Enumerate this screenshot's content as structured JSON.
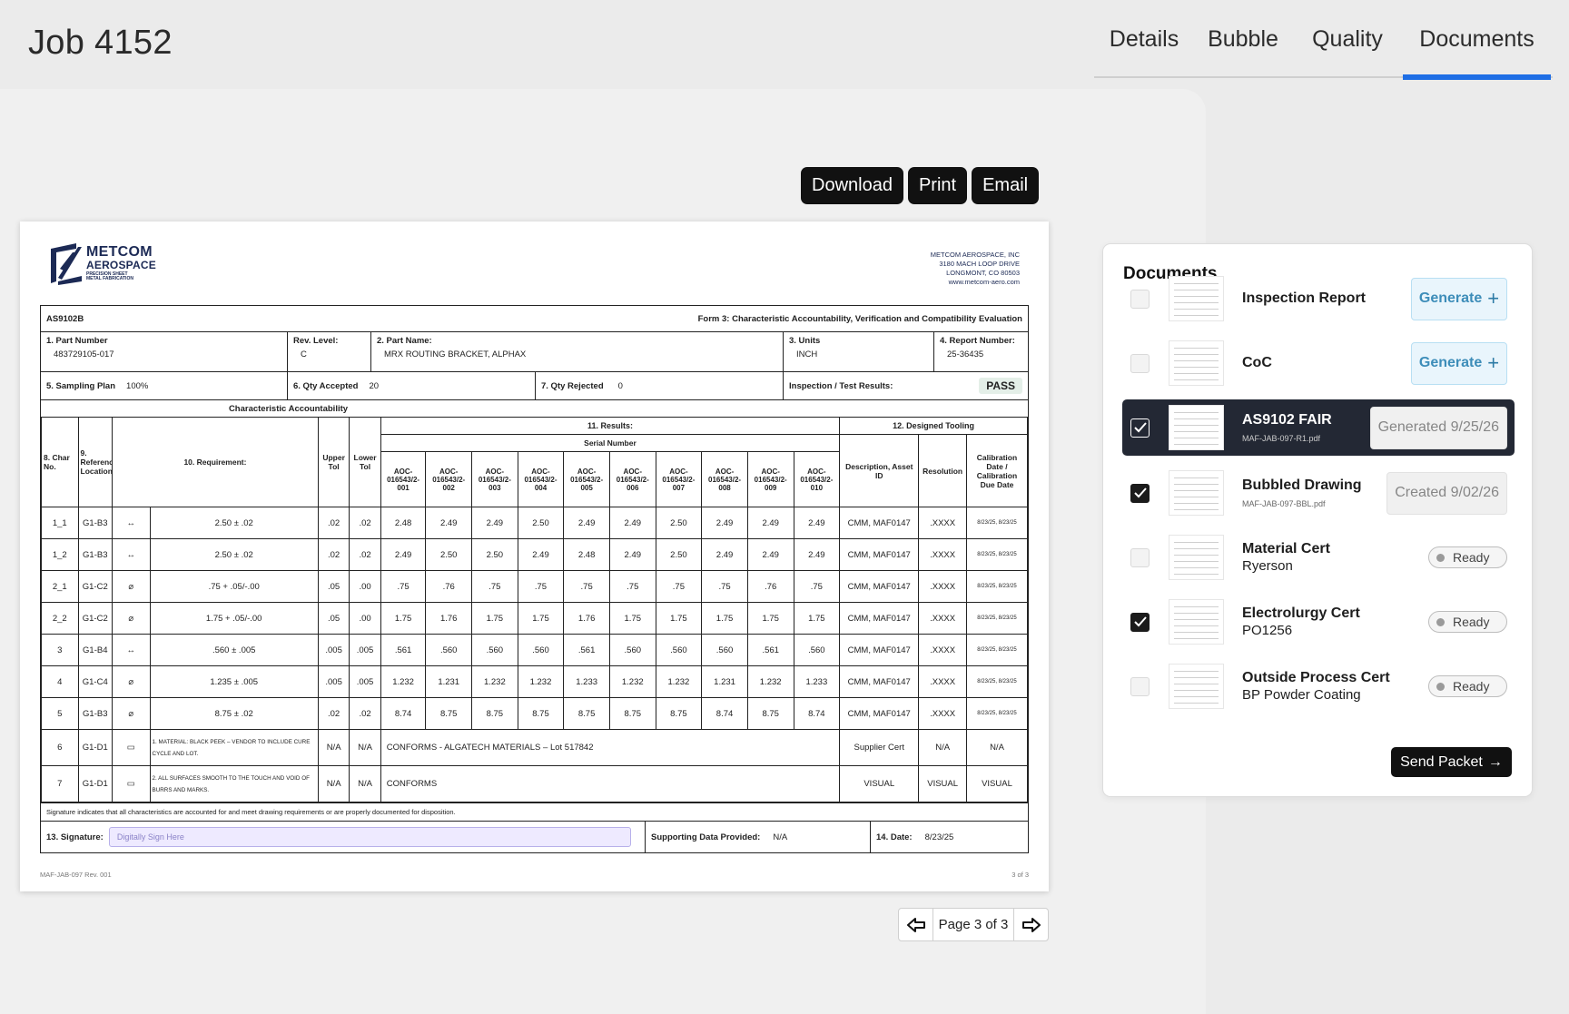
{
  "header": {
    "title": "Job 4152",
    "tabs": [
      {
        "label": "Details"
      },
      {
        "label": "Bubble"
      },
      {
        "label": "Quality"
      },
      {
        "label": "Documents"
      }
    ],
    "active_tab": "Documents"
  },
  "toolbar": {
    "download": "Download",
    "print": "Print",
    "email": "Email"
  },
  "document": {
    "logo_line1": "METCOM",
    "logo_line2": "AEROSPACE",
    "logo_line3": "PRECISION SHEET",
    "logo_line4": "METAL FABRICATION",
    "address": [
      "METCOM AEROSPACE, INC",
      "3180 MACH LOOP DRIVE",
      "LONGMONT, CO 80503",
      "www.metcom-aero.com"
    ],
    "standard": "AS9102B",
    "form_title": "Form 3: Characteristic Accountability, Verification and Compatibility Evaluation",
    "part_number_label": "1. Part Number",
    "part_number": "483729105-017",
    "rev_label": "Rev. Level:",
    "rev": "C",
    "part_name_label": "2. Part Name:",
    "part_name": "MRX ROUTING BRACKET, ALPHAX",
    "units_label": "3. Units",
    "units": "INCH",
    "report_label": "4. Report Number:",
    "report": "25-36435",
    "sampling_label": "5. Sampling Plan",
    "sampling": "100%",
    "qty_acc_label": "6. Qty Accepted",
    "qty_acc": "20",
    "qty_rej_label": "7. Qty Rejected",
    "qty_rej": "0",
    "results_label": "Inspection / Test Results:",
    "results": "PASS",
    "section_title": "Characteristic Accountability",
    "h_char": "8. Char No.",
    "h_ref": "9. Reference Location:",
    "h_req": "10. Requirement:",
    "h_upper": "Upper Tol",
    "h_lower": "Lower Tol",
    "h_results": "11. Results:",
    "h_serial": "Serial Number",
    "h_tooling": "12. Designed Tooling",
    "h_desc": "Description, Asset ID",
    "h_res": "Resolution",
    "h_cal": "Calibration Date / Calibration Due Date",
    "serials": [
      "AOC-016543/2-001",
      "AOC-016543/2-002",
      "AOC-016543/2-003",
      "AOC-016543/2-004",
      "AOC-016543/2-005",
      "AOC-016543/2-006",
      "AOC-016543/2-007",
      "AOC-016543/2-008",
      "AOC-016543/2-009",
      "AOC-016543/2-010"
    ],
    "rows": [
      {
        "no": "1_1",
        "ref": "G1-B3",
        "sym": "↔",
        "req": "2.50 ± .02",
        "up": ".02",
        "lo": ".02",
        "vals": [
          "2.48",
          "2.49",
          "2.49",
          "2.50",
          "2.49",
          "2.49",
          "2.50",
          "2.49",
          "2.49",
          "2.49"
        ],
        "desc": "CMM, MAF0147",
        "res": ".XXXX",
        "cal": "8/23/25, 8/23/25"
      },
      {
        "no": "1_2",
        "ref": "G1-B3",
        "sym": "↔",
        "req": "2.50 ± .02",
        "up": ".02",
        "lo": ".02",
        "vals": [
          "2.49",
          "2.50",
          "2.50",
          "2.49",
          "2.48",
          "2.49",
          "2.50",
          "2.49",
          "2.49",
          "2.49"
        ],
        "desc": "CMM, MAF0147",
        "res": ".XXXX",
        "cal": "8/23/25, 8/23/25"
      },
      {
        "no": "2_1",
        "ref": "G1-C2",
        "sym": "⌀",
        "req": ".75 + .05/-.00",
        "up": ".05",
        "lo": ".00",
        "vals": [
          ".75",
          ".76",
          ".75",
          ".75",
          ".75",
          ".75",
          ".75",
          ".75",
          ".76",
          ".75"
        ],
        "desc": "CMM, MAF0147",
        "res": ".XXXX",
        "cal": "8/23/25, 8/23/25"
      },
      {
        "no": "2_2",
        "ref": "G1-C2",
        "sym": "⌀",
        "req": "1.75 + .05/-.00",
        "up": ".05",
        "lo": ".00",
        "vals": [
          "1.75",
          "1.76",
          "1.75",
          "1.75",
          "1.76",
          "1.75",
          "1.75",
          "1.75",
          "1.75",
          "1.75"
        ],
        "desc": "CMM, MAF0147",
        "res": ".XXXX",
        "cal": "8/23/25, 8/23/25"
      },
      {
        "no": "3",
        "ref": "G1-B4",
        "sym": "↔",
        "req": ".560 ± .005",
        "up": ".005",
        "lo": ".005",
        "vals": [
          ".561",
          ".560",
          ".560",
          ".560",
          ".561",
          ".560",
          ".560",
          ".560",
          ".561",
          ".560"
        ],
        "desc": "CMM, MAF0147",
        "res": ".XXXX",
        "cal": "8/23/25, 8/23/25"
      },
      {
        "no": "4",
        "ref": "G1-C4",
        "sym": "⌀",
        "req": "1.235 ± .005",
        "up": ".005",
        "lo": ".005",
        "vals": [
          "1.232",
          "1.231",
          "1.232",
          "1.232",
          "1.233",
          "1.232",
          "1.232",
          "1.231",
          "1.232",
          "1.233"
        ],
        "desc": "CMM, MAF0147",
        "res": ".XXXX",
        "cal": "8/23/25, 8/23/25"
      },
      {
        "no": "5",
        "ref": "G1-B3",
        "sym": "⌀",
        "req": "8.75 ± .02",
        "up": ".02",
        "lo": ".02",
        "vals": [
          "8.74",
          "8.75",
          "8.75",
          "8.75",
          "8.75",
          "8.75",
          "8.75",
          "8.74",
          "8.75",
          "8.74"
        ],
        "desc": "CMM, MAF0147",
        "res": ".XXXX",
        "cal": "8/23/25, 8/23/25"
      }
    ],
    "note_rows": [
      {
        "no": "6",
        "ref": "G1-D1",
        "sym": "▭",
        "req": "1. MATERIAL: BLACK PEEK – VENDOR TO INCLUDE CURE CYCLE AND LOT.",
        "up": "N/A",
        "lo": "N/A",
        "result": "CONFORMS - ALGATECH MATERIALS – Lot 517842",
        "desc": "Supplier Cert",
        "res": "N/A",
        "cal": "N/A"
      },
      {
        "no": "7",
        "ref": "G1-D1",
        "sym": "▭",
        "req": "2. ALL SURFACES SMOOTH TO THE TOUCH AND VOID OF BURRS AND MARKS.",
        "up": "N/A",
        "lo": "N/A",
        "result": "CONFORMS",
        "desc": "VISUAL",
        "res": "VISUAL",
        "cal": "VISUAL"
      }
    ],
    "signature_note": "Signature indicates that all characteristics are accounted for and meet drawing requirements or are properly documented for disposition.",
    "signature_label": "13. Signature:",
    "signature_placeholder": "Digitally Sign Here",
    "supporting_label": "Supporting Data Provided:",
    "supporting": "N/A",
    "date_label": "14. Date:",
    "date": "8/23/25",
    "footer_left": "MAF-JAB-097 Rev. 001",
    "footer_right": "3 of 3"
  },
  "pager": {
    "label": "Page 3 of 3"
  },
  "documents_panel": {
    "title": "Documents",
    "items": [
      {
        "title": "Inspection Report",
        "sub": "",
        "action": "Generate",
        "checked": false
      },
      {
        "title": "CoC",
        "sub": "",
        "action": "Generate",
        "checked": false
      },
      {
        "title": "AS9102 FAIR",
        "sub": "MAF-JAB-097-R1.pdf",
        "status": "Generated 9/25/26",
        "checked": true
      },
      {
        "title": "Bubbled Drawing",
        "sub": "MAF-JAB-097-BBL.pdf",
        "status": "Created 9/02/26",
        "checked": true
      },
      {
        "title": "Material Cert",
        "sub2": "Ryerson",
        "badge": "Ready",
        "checked": false
      },
      {
        "title": "Electrolurgy Cert",
        "sub2": "PO1256",
        "badge": "Ready",
        "checked": true
      },
      {
        "title": "Outside Process Cert",
        "sub2": "BP Powder Coating",
        "badge": "Ready",
        "checked": false
      }
    ],
    "send_label": "Send Packet"
  },
  "colors": {
    "accent": "#1e6ee5",
    "generate_bg": "#e9f5fc",
    "selected_row": "#232834"
  }
}
